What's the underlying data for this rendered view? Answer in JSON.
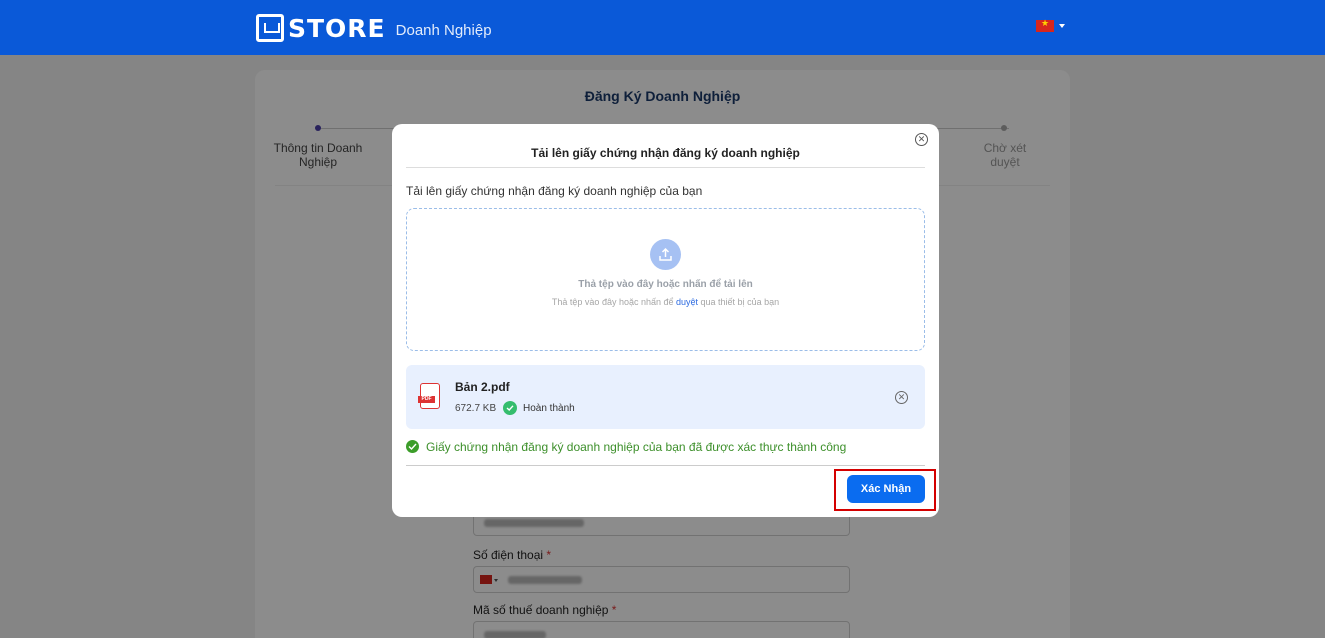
{
  "header": {
    "logo_text": "STORE",
    "logo_subtitle": "Doanh Nghiệp",
    "language_flag": "flag-vn-icon"
  },
  "page": {
    "title": "Đăng Ký Doanh Nghiệp",
    "steps": [
      {
        "label": "Thông tin Doanh Nghiệp"
      },
      {
        "label": "Chờ xét duyệt"
      }
    ],
    "fields": {
      "phone_label": "Số điện thoại",
      "tax_label": "Mã số thuế doanh nghiệp",
      "required_mark": "*"
    }
  },
  "modal": {
    "title": "Tải lên giấy chứng nhận đăng ký doanh nghiệp",
    "description": "Tải lên giấy chứng nhận đăng ký doanh nghiệp của bạn",
    "dropzone": {
      "main_text": "Thả tệp vào đây hoặc nhấn để tải lên",
      "sub_text_before": "Thả tệp vào đây hoặc nhấn để ",
      "sub_link": "duyệt",
      "sub_text_after": " qua thiết bị của bạn"
    },
    "file": {
      "name": "Bản 2.pdf",
      "size": "672.7 KB",
      "status": "Hoàn thành",
      "type_badge": "PDF"
    },
    "success_message": "Giấy chứng nhận đăng ký doanh nghiệp của bạn đã được xác thực thành công",
    "confirm_label": "Xác Nhận"
  },
  "colors": {
    "header_bg": "#0a59d8",
    "primary_button": "#0a6cf0",
    "success_green": "#3c8f2a",
    "highlight_red": "#d40000"
  }
}
